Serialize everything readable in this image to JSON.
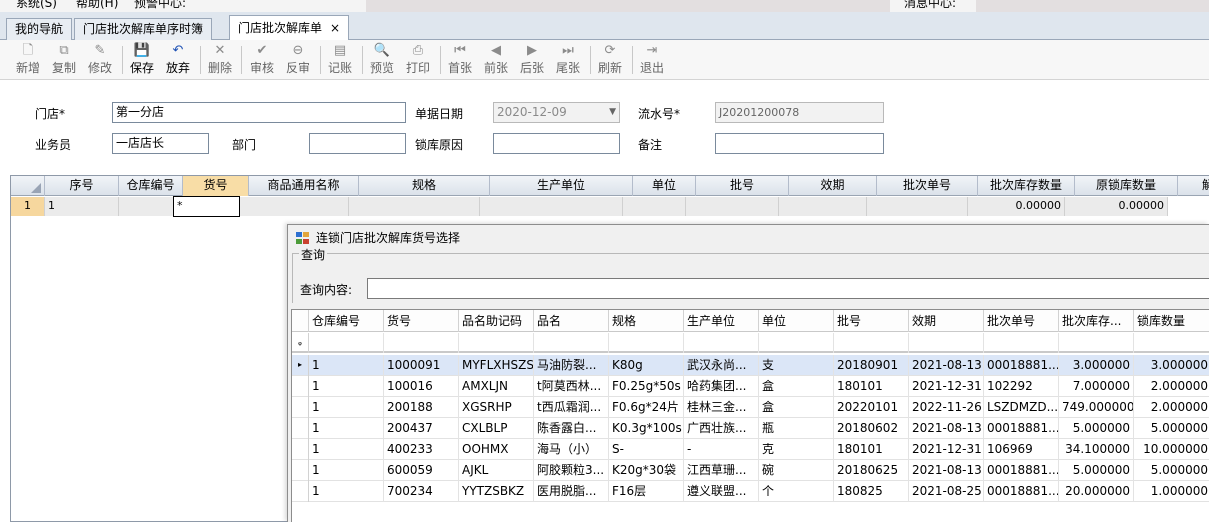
{
  "menu": {
    "items": [
      "系统(S)",
      "帮助(H)",
      "预警中心:",
      "消息中心:"
    ]
  },
  "tabs": [
    {
      "label": "我的导航"
    },
    {
      "label": "门店批次解库单序时簿"
    },
    {
      "label": "门店批次解库单",
      "close": "×"
    }
  ],
  "toolbar": {
    "buttons": [
      {
        "label": "新增",
        "icon": "new-doc-icon",
        "glyph": "🗋"
      },
      {
        "label": "复制",
        "icon": "copy-icon",
        "glyph": "⧉"
      },
      {
        "label": "修改",
        "icon": "edit-icon",
        "glyph": "✎"
      },
      {
        "label": "保存",
        "icon": "save-icon",
        "glyph": "💾"
      },
      {
        "label": "放弃",
        "icon": "undo-icon",
        "glyph": "↶"
      },
      {
        "label": "删除",
        "icon": "delete-icon",
        "glyph": "✕"
      },
      {
        "label": "审核",
        "icon": "approve-icon",
        "glyph": "✔"
      },
      {
        "label": "反审",
        "icon": "unapprove-icon",
        "glyph": "⊖"
      },
      {
        "label": "记账",
        "icon": "ledger-icon",
        "glyph": "▤"
      },
      {
        "label": "预览",
        "icon": "preview-icon",
        "glyph": "🔍"
      },
      {
        "label": "打印",
        "icon": "print-icon",
        "glyph": "⎙"
      },
      {
        "label": "首张",
        "icon": "first-icon",
        "glyph": "⏮"
      },
      {
        "label": "前张",
        "icon": "prev-icon",
        "glyph": "◀"
      },
      {
        "label": "后张",
        "icon": "next-icon",
        "glyph": "▶"
      },
      {
        "label": "尾张",
        "icon": "last-icon",
        "glyph": "⏭"
      },
      {
        "label": "刷新",
        "icon": "refresh-icon",
        "glyph": "⟳"
      },
      {
        "label": "退出",
        "icon": "exit-icon",
        "glyph": "⇥"
      }
    ]
  },
  "form": {
    "store_label": "门店*",
    "store_value": "第一分店",
    "date_label": "单据日期",
    "date_value": "2020-12-09",
    "serial_label": "流水号*",
    "serial_value": "J20201200078",
    "staff_label": "业务员",
    "staff_value": "一店店长",
    "dept_label": "部门",
    "dept_value": "",
    "reason_label": "锁库原因",
    "reason_value": "",
    "remark_label": "备注",
    "remark_value": ""
  },
  "grid": {
    "headers": [
      "序号",
      "仓库编号",
      "货号",
      "商品通用名称",
      "规格",
      "生产单位",
      "单位",
      "批号",
      "效期",
      "批次单号",
      "批次库存数量",
      "原锁库数量",
      "解库"
    ],
    "row": {
      "indicator": "1",
      "seq": "1",
      "goods": "*",
      "stock_qty": "0.00000",
      "orig_lock_qty": "0.00000"
    }
  },
  "dialog": {
    "title": "连锁门店批次解库货号选择",
    "group_title": "查询",
    "query_label": "查询内容:",
    "query_value": "",
    "headers": [
      "仓库编号",
      "货号",
      "品名助记码",
      "品名",
      "规格",
      "生产单位",
      "单位",
      "批号",
      "效期",
      "批次单号",
      "批次库存...",
      "锁库数量"
    ],
    "filter_icon": "ᵩ",
    "current_row_marker": "▸",
    "rows": [
      [
        "1",
        "1000091",
        "MYFLXHSZS",
        "马油防裂...",
        "K80g",
        "武汉永尚...",
        "支",
        "20180901",
        "2021-08-13",
        "00018881...",
        "3.000000",
        "3.000000"
      ],
      [
        "1",
        "100016",
        "AMXLJN",
        "t阿莫西林...",
        "F0.25g*50s",
        "哈药集团...",
        "盒",
        "180101",
        "2021-12-31",
        "102292",
        "7.000000",
        "2.000000"
      ],
      [
        "1",
        "200188",
        "XGSRHP",
        "t西瓜霜润...",
        "F0.6g*24片",
        "桂林三金...",
        "盒",
        "20220101",
        "2022-11-26",
        "LSZDMZD...",
        "749.000000",
        "2.000000"
      ],
      [
        "1",
        "200437",
        "CXLBLP",
        "陈香露白...",
        "K0.3g*100s",
        "广西壮族...",
        "瓶",
        "20180602",
        "2021-08-13",
        "00018881...",
        "5.000000",
        "5.000000"
      ],
      [
        "1",
        "400233",
        "OOHMX",
        "海马（小）",
        "S-",
        "-",
        "克",
        "180101",
        "2021-12-31",
        "106969",
        "34.100000",
        "10.000000"
      ],
      [
        "1",
        "600059",
        "AJKL",
        "阿胶颗粒3...",
        "K20g*30袋",
        "江西草珊...",
        "碗",
        "20180625",
        "2021-08-13",
        "00018881...",
        "5.000000",
        "5.000000"
      ],
      [
        "1",
        "700234",
        "YYTZSBKZ",
        "医用脱脂...",
        "F16层",
        "遵义联盟...",
        "个",
        "180825",
        "2021-08-25",
        "00018881...",
        "20.000000",
        "1.000000"
      ]
    ]
  }
}
